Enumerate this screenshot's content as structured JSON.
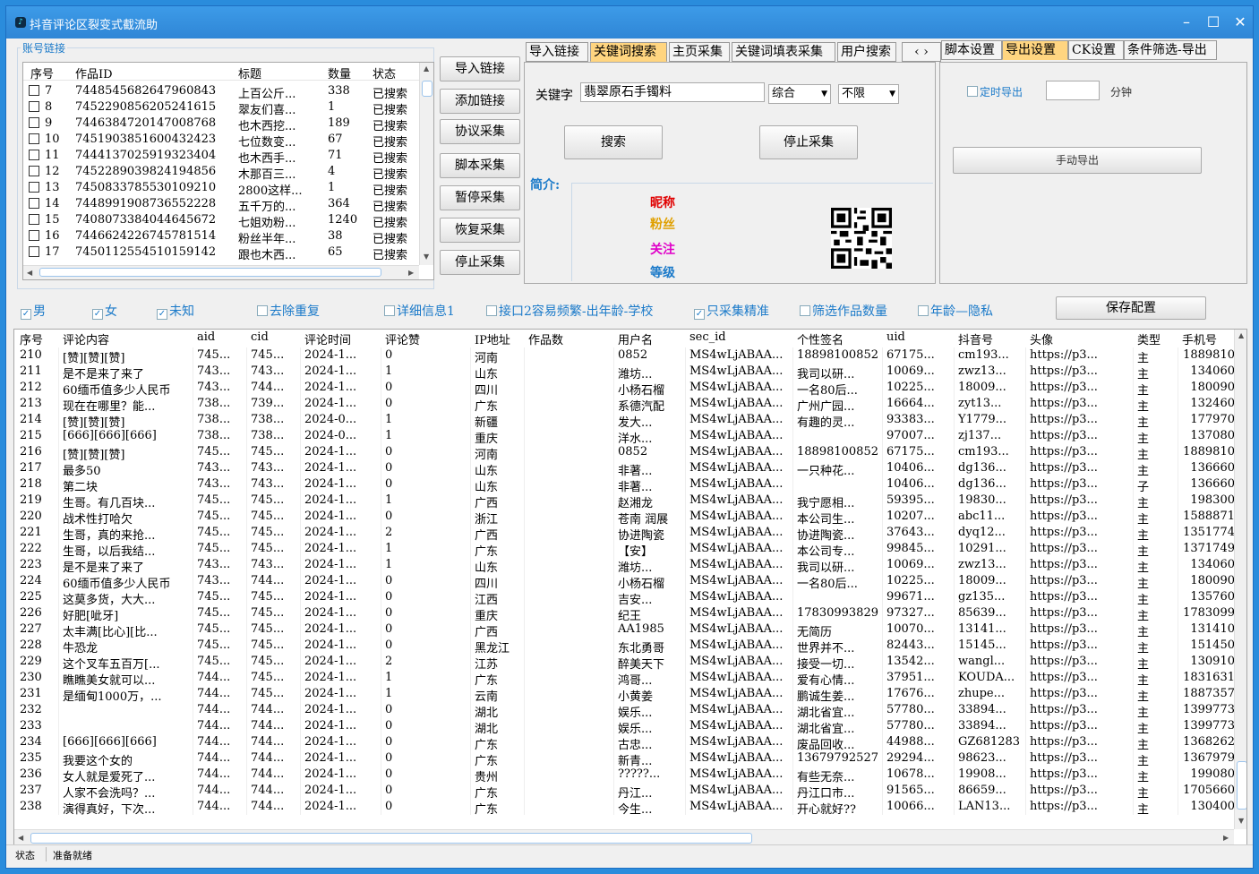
{
  "window": {
    "title": "抖音评论区裂变式截流助"
  },
  "account_group": {
    "label": "账号链接"
  },
  "account_table": {
    "columns": [
      "序号",
      "作品ID",
      "标题",
      "数量",
      "状态"
    ],
    "rows": [
      [
        "7",
        "7448545682647960843",
        "上百公斤...",
        "338",
        "已搜索"
      ],
      [
        "8",
        "7452290856205241615",
        "翠友们喜...",
        "1",
        "已搜索"
      ],
      [
        "9",
        "7446384720147008768",
        "也木西挖...",
        "189",
        "已搜索"
      ],
      [
        "10",
        "7451903851600432423",
        "七位数变...",
        "67",
        "已搜索"
      ],
      [
        "11",
        "7444137025919323404",
        "也木西手...",
        "71",
        "已搜索"
      ],
      [
        "12",
        "7452289039824194856",
        "木那百三...",
        "4",
        "已搜索"
      ],
      [
        "13",
        "7450833785530109210",
        "2800这样...",
        "1",
        "已搜索"
      ],
      [
        "14",
        "7448991908736552228",
        "五千万的...",
        "364",
        "已搜索"
      ],
      [
        "15",
        "7408073384044645672",
        "七姐劝粉...",
        "1240",
        "已搜索"
      ],
      [
        "16",
        "7446624226745781514",
        "粉丝半年...",
        "38",
        "已搜索"
      ],
      [
        "17",
        "7450112554510159142",
        "跟也木西...",
        "65",
        "已搜索"
      ]
    ]
  },
  "side_buttons": [
    "导入链接",
    "添加链接",
    "协议采集",
    "脚本采集",
    "暂停采集",
    "恢复采集",
    "停止采集"
  ],
  "search_tabs": [
    "导入链接",
    "关键词搜索",
    "主页采集",
    "关键词填表采集",
    "用户搜索"
  ],
  "search": {
    "keyword_label": "关键字",
    "keyword_value": "翡翠原石手镯料",
    "sort_value": "综合",
    "range_value": "不限",
    "search_button": "搜索",
    "stop_button": "停止采集",
    "intro_label": "简介:",
    "profile": {
      "nickname": "昵称",
      "fans": "粉丝",
      "follow": "关注",
      "level": "等级"
    }
  },
  "settings_tabs": [
    "脚本设置",
    "导出设置",
    "CK设置",
    "条件筛选-导出"
  ],
  "export": {
    "timer_label": "定时导出",
    "minutes_value": "",
    "minutes_unit": "分钟",
    "manual_button": "手动导出"
  },
  "filters": [
    {
      "label": "男",
      "checked": true
    },
    {
      "label": "女",
      "checked": true
    },
    {
      "label": "未知",
      "checked": true
    },
    {
      "label": "去除重复",
      "checked": false
    },
    {
      "label": "详细信息1",
      "checked": false
    },
    {
      "label": "接口2容易频繁-出年龄-学校",
      "checked": false
    },
    {
      "label": "只采集精准",
      "checked": true
    },
    {
      "label": "筛选作品数量",
      "checked": false
    },
    {
      "label": "年龄—隐私",
      "checked": false
    }
  ],
  "save_button": "保存配置",
  "grid": {
    "columns": [
      "序号",
      "评论内容",
      "aid",
      "cid",
      "评论时间",
      "评论赞",
      "IP地址",
      "作品数",
      "用户名",
      "sec_id",
      "个性签名",
      "uid",
      "抖音号",
      "头像",
      "类型",
      "手机号"
    ],
    "rows": [
      [
        "210",
        "[赞][赞][赞]",
        "745...",
        "745...",
        "2024-1...",
        "0",
        "河南",
        "",
        "0852",
        "MS4wLjABAA...",
        "18898100852",
        "67175...",
        "cm193...",
        "https://p3...",
        "主",
        "1889810"
      ],
      [
        "211",
        "是不是来了来了",
        "743...",
        "743...",
        "2024-1...",
        "1",
        "山东",
        "",
        "潍坊...",
        "MS4wLjABAA...",
        "我司以研...",
        "10069...",
        "zwz13...",
        "https://p3...",
        "主",
        "134060"
      ],
      [
        "212",
        "60缅币值多少人民币",
        "743...",
        "744...",
        "2024-1...",
        "0",
        "四川",
        "",
        "小杨石榴",
        "MS4wLjABAA...",
        "一名80后...",
        "10225...",
        "18009...",
        "https://p3...",
        "主",
        "180090"
      ],
      [
        "213",
        "现在在哪里？能...",
        "738...",
        "739...",
        "2024-1...",
        "0",
        "广东",
        "",
        "系德汽配",
        "MS4wLjABAA...",
        "广州广园...",
        "16664...",
        "zyt13...",
        "https://p3...",
        "主",
        "132460"
      ],
      [
        "214",
        "[赞][赞][赞]",
        "738...",
        "738...",
        "2024-0...",
        "1",
        "新疆",
        "",
        "发大...",
        "MS4wLjABAA...",
        "有趣的灵...",
        "93383...",
        "Y1779...",
        "https://p3...",
        "主",
        "177970"
      ],
      [
        "215",
        "[666][666][666]",
        "738...",
        "738...",
        "2024-0...",
        "1",
        "重庆",
        "",
        "洋水...",
        "MS4wLjABAA...",
        "",
        "97007...",
        "zj137...",
        "https://p3...",
        "主",
        "137080"
      ],
      [
        "216",
        "[赞][赞][赞]",
        "745...",
        "745...",
        "2024-1...",
        "0",
        "河南",
        "",
        "0852",
        "MS4wLjABAA...",
        "18898100852",
        "67175...",
        "cm193...",
        "https://p3...",
        "主",
        "1889810"
      ],
      [
        "217",
        "最多50",
        "743...",
        "743...",
        "2024-1...",
        "0",
        "山东",
        "",
        "非著...",
        "MS4wLjABAA...",
        "一只种花...",
        "10406...",
        "dg136...",
        "https://p3...",
        "主",
        "136660"
      ],
      [
        "218",
        "第二块",
        "743...",
        "743...",
        "2024-1...",
        "0",
        "山东",
        "",
        "非著...",
        "MS4wLjABAA...",
        "",
        "10406...",
        "dg136...",
        "https://p3...",
        "子",
        "136660"
      ],
      [
        "219",
        "生哥。有几百块...",
        "745...",
        "745...",
        "2024-1...",
        "1",
        "广西",
        "",
        "赵湘龙",
        "MS4wLjABAA...",
        "我宁愿相...",
        "59395...",
        "19830...",
        "https://p3...",
        "主",
        "198300"
      ],
      [
        "220",
        "战术性打哈欠",
        "745...",
        "745...",
        "2024-1...",
        "0",
        "浙江",
        "",
        "苍南 润展",
        "MS4wLjABAA...",
        "本公司生...",
        "10207...",
        "abc11...",
        "https://p3...",
        "主",
        "1588871"
      ],
      [
        "221",
        "生哥，真的来抢...",
        "745...",
        "745...",
        "2024-1...",
        "2",
        "广西",
        "",
        "协进陶瓷",
        "MS4wLjABAA...",
        "协进陶瓷...",
        "37643...",
        "dyq12...",
        "https://p3...",
        "主",
        "1351774"
      ],
      [
        "222",
        "生哥，以后我结...",
        "745...",
        "745...",
        "2024-1...",
        "1",
        "广东",
        "",
        "【安】",
        "MS4wLjABAA...",
        "本公司专...",
        "99845...",
        "10291...",
        "https://p3...",
        "主",
        "1371749"
      ],
      [
        "223",
        "是不是来了来了",
        "743...",
        "743...",
        "2024-1...",
        "1",
        "山东",
        "",
        "潍坊...",
        "MS4wLjABAA...",
        "我司以研...",
        "10069...",
        "zwz13...",
        "https://p3...",
        "主",
        "134060"
      ],
      [
        "224",
        "60缅币值多少人民币",
        "743...",
        "744...",
        "2024-1...",
        "0",
        "四川",
        "",
        "小杨石榴",
        "MS4wLjABAA...",
        "一名80后...",
        "10225...",
        "18009...",
        "https://p3...",
        "主",
        "180090"
      ],
      [
        "225",
        "这莫多货，大大...",
        "745...",
        "745...",
        "2024-1...",
        "0",
        "江西",
        "",
        "吉安...",
        "MS4wLjABAA...",
        "",
        "99671...",
        "gz135...",
        "https://p3...",
        "主",
        "135760"
      ],
      [
        "226",
        "好肥[呲牙]",
        "745...",
        "745...",
        "2024-1...",
        "0",
        "重庆",
        "",
        "纪王",
        "MS4wLjABAA...",
        "17830993829",
        "97327...",
        "85639...",
        "https://p3...",
        "主",
        "1783099"
      ],
      [
        "227",
        "太丰满[比心][比...",
        "745...",
        "745...",
        "2024-1...",
        "0",
        "广西",
        "",
        "AA1985",
        "MS4wLjABAA...",
        "无简历",
        "10070...",
        "13141...",
        "https://p3...",
        "主",
        "131410"
      ],
      [
        "228",
        "牛恐龙",
        "745...",
        "745...",
        "2024-1...",
        "0",
        "黑龙江",
        "",
        "东北勇哥",
        "MS4wLjABAA...",
        "世界并不...",
        "82443...",
        "15145...",
        "https://p3...",
        "主",
        "151450"
      ],
      [
        "229",
        "这个叉车五百万[...",
        "745...",
        "745...",
        "2024-1...",
        "2",
        "江苏",
        "",
        "醉美天下",
        "MS4wLjABAA...",
        "接受一切...",
        "13542...",
        "wangl...",
        "https://p3...",
        "主",
        "130910"
      ],
      [
        "230",
        "瞧瞧美女就可以...",
        "744...",
        "745...",
        "2024-1...",
        "1",
        "广东",
        "",
        "鸿哥...",
        "MS4wLjABAA...",
        "爱有心情...",
        "37951...",
        "KOUDA...",
        "https://p3...",
        "主",
        "1831631"
      ],
      [
        "231",
        "是缅甸1000万，...",
        "744...",
        "745...",
        "2024-1...",
        "1",
        "云南",
        "",
        "小黄姜",
        "MS4wLjABAA...",
        "鹏诚生姜...",
        "17676...",
        "zhupe...",
        "https://p3...",
        "主",
        "1887357"
      ],
      [
        "232",
        "",
        "744...",
        "744...",
        "2024-1...",
        "0",
        "湖北",
        "",
        "娱乐...",
        "MS4wLjABAA...",
        "湖北省宜...",
        "57780...",
        "33894...",
        "https://p3...",
        "主",
        "1399773"
      ],
      [
        "233",
        "",
        "744...",
        "744...",
        "2024-1...",
        "0",
        "湖北",
        "",
        "娱乐...",
        "MS4wLjABAA...",
        "湖北省宜...",
        "57780...",
        "33894...",
        "https://p3...",
        "主",
        "1399773"
      ],
      [
        "234",
        "[666][666][666]",
        "744...",
        "744...",
        "2024-1...",
        "0",
        "广东",
        "",
        "古忠...",
        "MS4wLjABAA...",
        "废品回收...",
        "44988...",
        "GZ681283",
        "https://p3...",
        "主",
        "1368262"
      ],
      [
        "235",
        "我要这个女的",
        "744...",
        "744...",
        "2024-1...",
        "0",
        "广东",
        "",
        "新青...",
        "MS4wLjABAA...",
        "13679792527",
        "29294...",
        "98623...",
        "https://p3...",
        "主",
        "1367979"
      ],
      [
        "236",
        "女人就是爱死了...",
        "744...",
        "744...",
        "2024-1...",
        "0",
        "贵州",
        "",
        "?????...",
        "MS4wLjABAA...",
        "有些无奈...",
        "10678...",
        "19908...",
        "https://p3...",
        "主",
        "199080"
      ],
      [
        "237",
        "人家不会洗吗？...",
        "744...",
        "744...",
        "2024-1...",
        "0",
        "广东",
        "",
        "丹江...",
        "MS4wLjABAA...",
        "丹江口市...",
        "91565...",
        "86659...",
        "https://p3...",
        "主",
        "1705660"
      ],
      [
        "238",
        "演得真好，下次...",
        "744...",
        "744...",
        "2024-1...",
        "0",
        "广东",
        "",
        "今生...",
        "MS4wLjABAA...",
        "开心就好??",
        "10066...",
        "LAN13...",
        "https://p3...",
        "主",
        "130400"
      ]
    ]
  },
  "status": {
    "label": "状态",
    "value": "准备就绪"
  },
  "colors": {
    "nickname": "#e00000",
    "fans": "#e0a000",
    "follow": "#e000c8",
    "level": "#1b7ac9",
    "active_tab": "#ffd580",
    "titlebar": "#2f86d6"
  }
}
